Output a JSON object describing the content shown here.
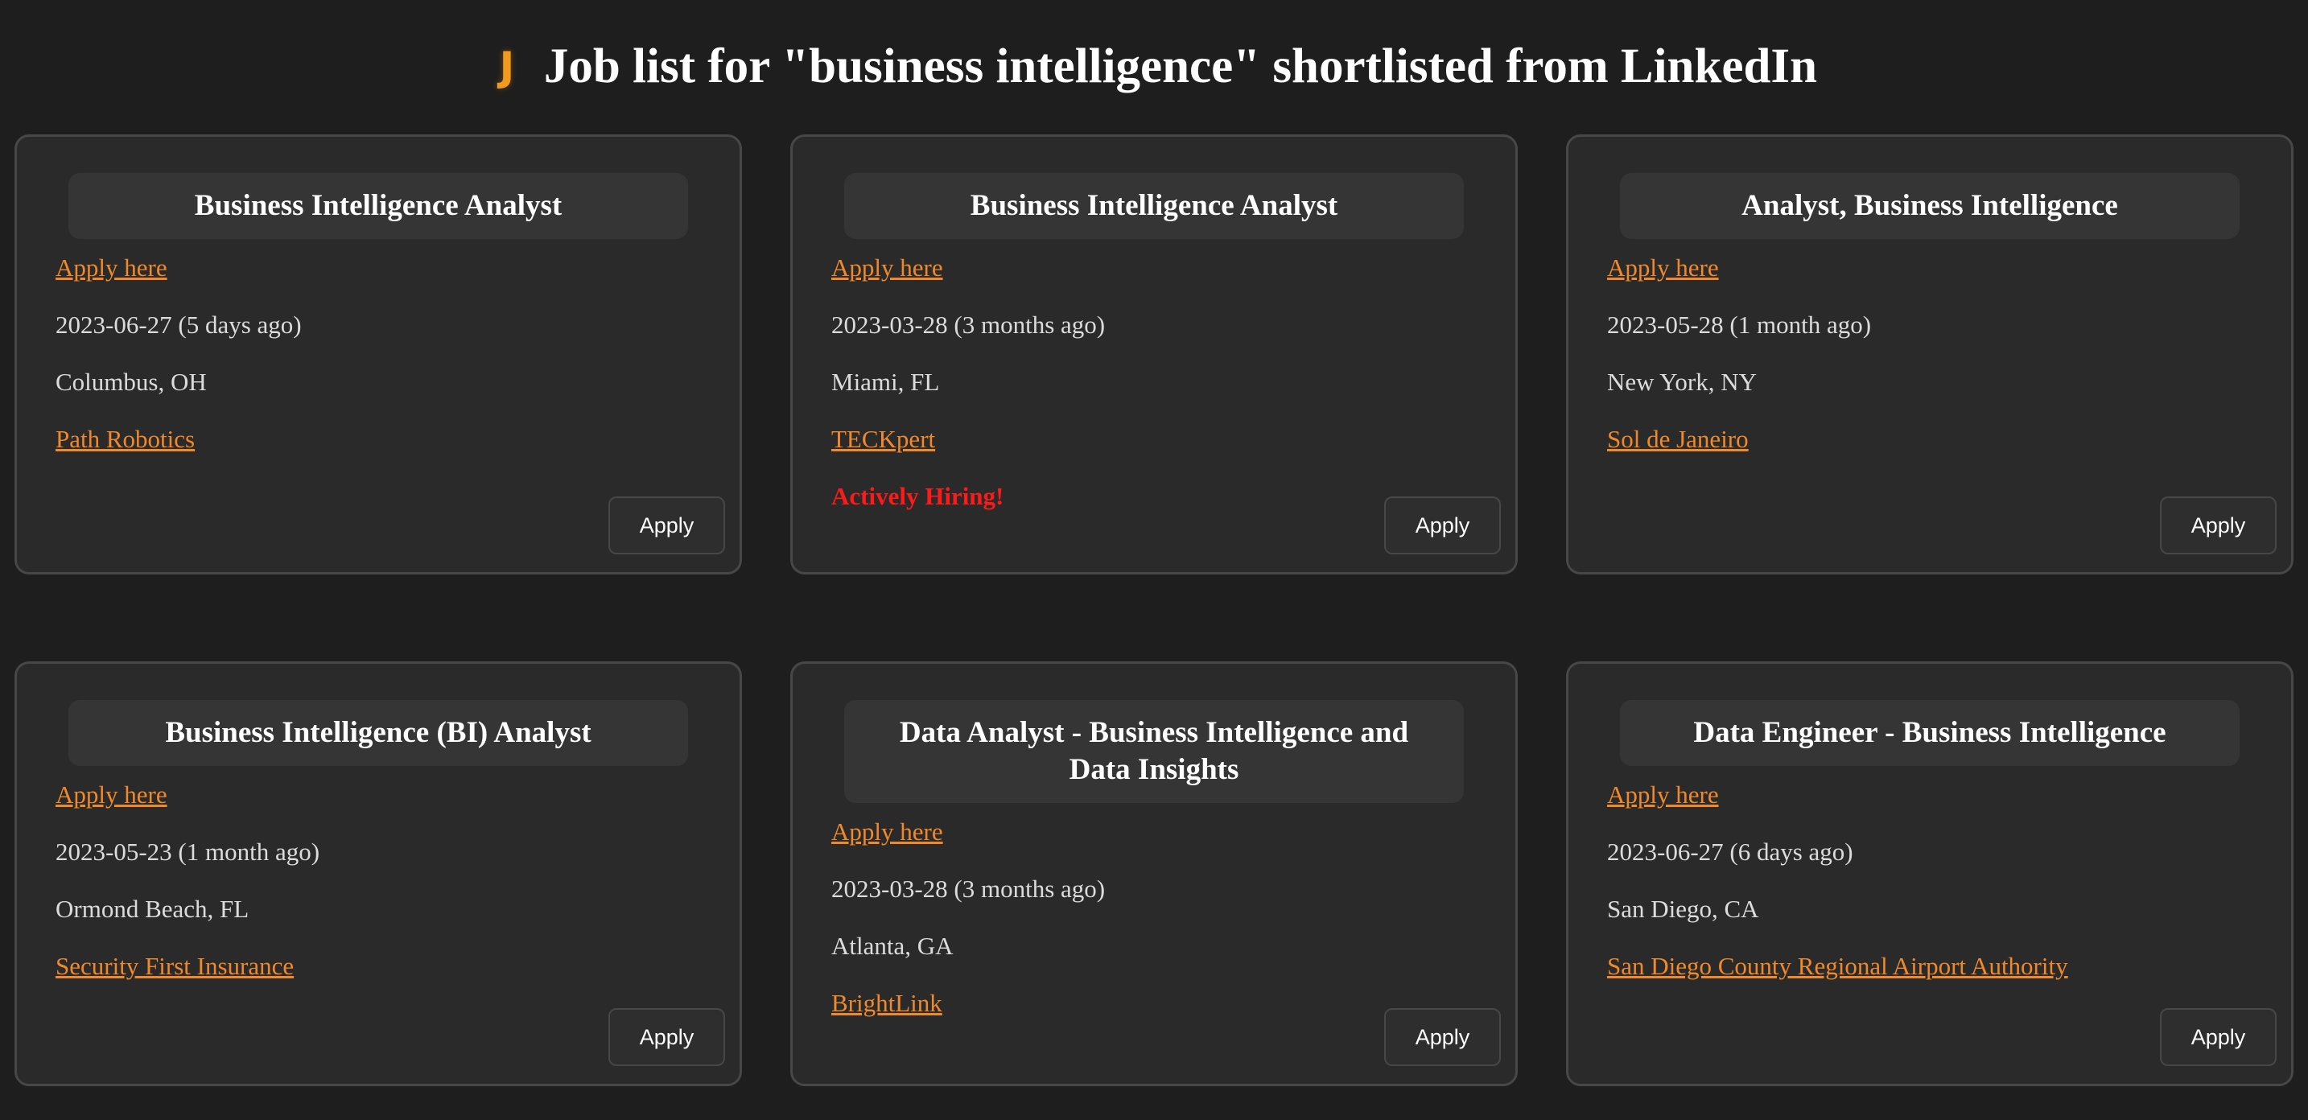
{
  "header": {
    "logo_glyph": "J",
    "title": "Job list for \"business intelligence\" shortlisted from LinkedIn"
  },
  "jobs": [
    {
      "title": "Business Intelligence Analyst",
      "apply_link": "Apply here",
      "date": "2023-06-27 (5 days ago)",
      "location": "Columbus, OH",
      "company": "Path Robotics",
      "hiring": "",
      "button": "Apply"
    },
    {
      "title": "Business Intelligence Analyst",
      "apply_link": "Apply here",
      "date": "2023-03-28 (3 months ago)",
      "location": "Miami, FL",
      "company": "TECKpert",
      "hiring": "Actively Hiring!",
      "button": "Apply"
    },
    {
      "title": "Analyst, Business Intelligence",
      "apply_link": "Apply here",
      "date": "2023-05-28 (1 month ago)",
      "location": "New York, NY",
      "company": "Sol de Janeiro",
      "hiring": "",
      "button": "Apply"
    },
    {
      "title": "Business Intelligence (BI) Analyst",
      "apply_link": "Apply here",
      "date": "2023-05-23 (1 month ago)",
      "location": "Ormond Beach, FL",
      "company": "Security First Insurance",
      "hiring": "",
      "button": "Apply"
    },
    {
      "title": "Data Analyst - Business Intelligence and Data Insights",
      "apply_link": "Apply here",
      "date": "2023-03-28 (3 months ago)",
      "location": "Atlanta, GA",
      "company": "BrightLink",
      "hiring": "",
      "button": "Apply"
    },
    {
      "title": "Data Engineer - Business Intelligence",
      "apply_link": "Apply here",
      "date": "2023-06-27 (6 days ago)",
      "location": "San Diego, CA",
      "company": "San Diego County Regional Airport Authority",
      "hiring": "",
      "button": "Apply"
    }
  ],
  "colors": {
    "background": "#1e1e1e",
    "card": "#2a2a2a",
    "link": "#f0892a",
    "hiring": "#ff1a1a",
    "logo": "#f29a1c"
  }
}
